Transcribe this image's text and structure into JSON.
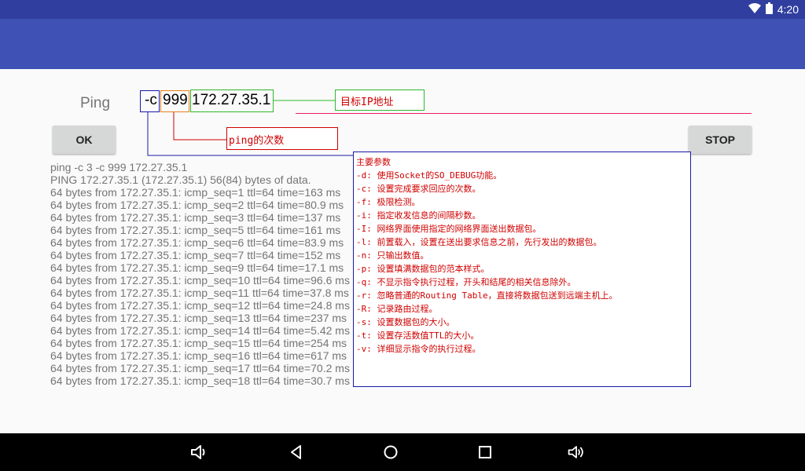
{
  "status_bar": {
    "time": "4:20",
    "icons": [
      "wifi-icon",
      "battery-icon"
    ]
  },
  "form": {
    "ping_label": "Ping",
    "flag": "-c",
    "count": "999",
    "ip": "172.27.35.1"
  },
  "buttons": {
    "ok": "OK",
    "stop": "STOP"
  },
  "output": {
    "lines": [
      "ping -c 3 -c 999 172.27.35.1",
      "PING 172.27.35.1 (172.27.35.1) 56(84) bytes of data.",
      "64 bytes from 172.27.35.1: icmp_seq=1 ttl=64 time=163 ms",
      "64 bytes from 172.27.35.1: icmp_seq=2 ttl=64 time=80.9 ms",
      "64 bytes from 172.27.35.1: icmp_seq=3 ttl=64 time=137 ms",
      "64 bytes from 172.27.35.1: icmp_seq=5 ttl=64 time=161 ms",
      "64 bytes from 172.27.35.1: icmp_seq=6 ttl=64 time=83.9 ms",
      "64 bytes from 172.27.35.1: icmp_seq=7 ttl=64 time=152 ms",
      "64 bytes from 172.27.35.1: icmp_seq=9 ttl=64 time=17.1 ms",
      "64 bytes from 172.27.35.1: icmp_seq=10 ttl=64 time=96.6 ms",
      "64 bytes from 172.27.35.1: icmp_seq=11 ttl=64 time=37.8 ms",
      "64 bytes from 172.27.35.1: icmp_seq=12 ttl=64 time=24.8 ms",
      "64 bytes from 172.27.35.1: icmp_seq=13 ttl=64 time=237 ms",
      "64 bytes from 172.27.35.1: icmp_seq=14 ttl=64 time=5.42 ms",
      "64 bytes from 172.27.35.1: icmp_seq=15 ttl=64 time=254 ms",
      "64 bytes from 172.27.35.1: icmp_seq=16 ttl=64 time=617 ms",
      "64 bytes from 172.27.35.1: icmp_seq=17 ttl=64 time=70.2 ms",
      "64 bytes from 172.27.35.1: icmp_seq=18 ttl=64 time=30.7 ms"
    ]
  },
  "annotations": {
    "ip_label": "目标IP地址",
    "count_label": "ping的次数",
    "params": [
      "主要参数",
      "-d: 使用Socket的SO_DEBUG功能。",
      "-c: 设置完成要求回应的次数。",
      "-f: 极限检测。",
      "-i: 指定收发信息的间隔秒数。",
      "-I: 网络界面使用指定的网络界面送出数据包。",
      "-l: 前置载入，设置在送出要求信息之前，先行发出的数据包。",
      "-n: 只输出数值。",
      "-p: 设置填满数据包的范本样式。",
      "-q: 不显示指令执行过程，开头和结尾的相关信息除外。",
      "-r: 忽略普通的Routing Table，直接将数据包送到远端主机上。",
      "-R: 记录路由过程。",
      "-s: 设置数据包的大小。",
      "-t: 设置存活数值TTL的大小。",
      "-v: 详细显示指令的执行过程。"
    ]
  },
  "colors": {
    "status_bar": "#303f9f",
    "app_bar": "#3f51b5",
    "accent_underline": "#e91e63",
    "annotation_text": "#d00000"
  },
  "nav_bar": {
    "icons": [
      "volume-down-icon",
      "back-icon",
      "home-icon",
      "recents-icon",
      "volume-up-icon"
    ]
  }
}
